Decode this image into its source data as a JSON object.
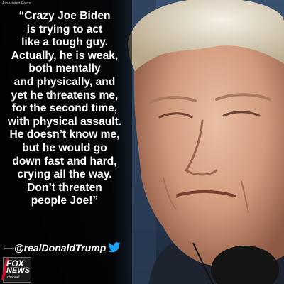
{
  "source_credit": "Associated Press",
  "quote_lines": [
    "“Crazy Joe Biden",
    "is trying to act",
    "like a tough guy.",
    "Actually, he is weak,",
    "both mentally",
    "and physically, and",
    "yet he threatens me,",
    "for the second time,",
    "with physical assault.",
    "He doesn’t know me,",
    "but he would go",
    "down fast and hard,",
    "crying all the way.",
    "Don’t threaten",
    "people Joe!”"
  ],
  "attribution": "—@realDonaldTrump",
  "logo": {
    "line1": "FOX",
    "line2": "NEWS",
    "line3": "channel"
  },
  "colors": {
    "text": "#ffffff",
    "twitter_blue": "#1da1f2",
    "panel": "#000000"
  },
  "icons": {
    "twitter": "twitter-bird-icon",
    "logo": "fox-news-logo"
  }
}
